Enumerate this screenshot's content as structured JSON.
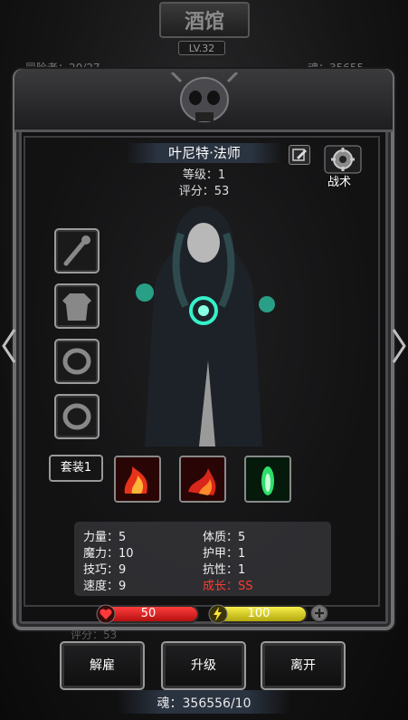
{
  "top": {
    "title": "酒馆",
    "level": "LV.32",
    "left_info": "冒险者：20/27",
    "right_info": "魂：35655..."
  },
  "hero": {
    "name": "叶尼特·法师",
    "level_text": "等级：1",
    "score_text": "评分：53",
    "tactic_label": "战术"
  },
  "equipment": {
    "slots": [
      "weapon-staff-slot",
      "armor-slot",
      "ring-slot-1",
      "ring-slot-2"
    ],
    "set_label": "套装1"
  },
  "skills": [
    "fire-skill-1",
    "fire-skill-2",
    "green-flame-skill"
  ],
  "stats": {
    "strength": "力量：5",
    "magic": "魔力：10",
    "skill": "技巧：9",
    "speed": "速度：9",
    "constitution": "体质：5",
    "armor": "护甲：1",
    "resistance": "抗性：1",
    "growth": "成长：SS"
  },
  "bars": {
    "hp": "50",
    "hp_fraction": 1.0,
    "energy": "100",
    "energy_fraction": 1.0
  },
  "ghost": {
    "score": "评分：53"
  },
  "actions": {
    "dismiss": "解雇",
    "upgrade": "升级",
    "leave": "离开"
  },
  "footer": {
    "soul": "魂：356556/10"
  },
  "colors": {
    "growth": "#ff3b2f",
    "hp": "#e01e1e",
    "energy": "#e6dc2a"
  }
}
